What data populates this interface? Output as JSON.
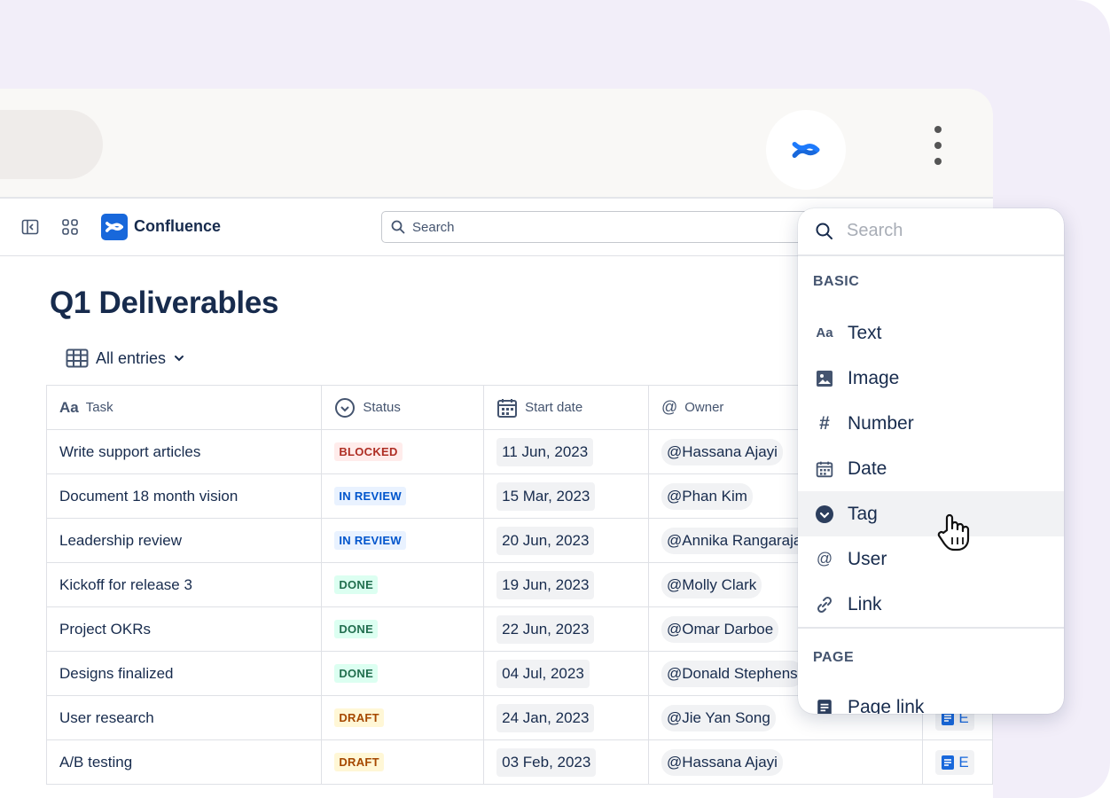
{
  "app": {
    "name": "Confluence",
    "search_placeholder": "Search"
  },
  "page": {
    "title": "Q1 Deliverables",
    "view_label": "All entries"
  },
  "table": {
    "columns": [
      {
        "icon": "text-type-icon",
        "label": "Task"
      },
      {
        "icon": "status-icon",
        "label": "Status"
      },
      {
        "icon": "calendar-icon",
        "label": "Start date"
      },
      {
        "icon": "at-icon",
        "label": "Owner"
      }
    ],
    "rows": [
      {
        "task": "Write support articles",
        "status": "BLOCKED",
        "status_color": "#ae2e24",
        "status_bg": "#ffeceb",
        "date": "11 Jun, 2023",
        "owner": "@Hassana Ajayi",
        "page": ""
      },
      {
        "task": "Document 18 month vision",
        "status": "IN REVIEW",
        "status_color": "#0055cc",
        "status_bg": "#e9f2ff",
        "date": "15 Mar, 2023",
        "owner": "@Phan Kim",
        "page": ""
      },
      {
        "task": "Leadership review",
        "status": "IN REVIEW",
        "status_color": "#0055cc",
        "status_bg": "#e9f2ff",
        "date": "20 Jun, 2023",
        "owner": "@Annika Rangarajan",
        "page": ""
      },
      {
        "task": "Kickoff for release 3",
        "status": "DONE",
        "status_color": "#216e4e",
        "status_bg": "#dcfff1",
        "date": "19 Jun, 2023",
        "owner": "@Molly Clark",
        "page": ""
      },
      {
        "task": "Project OKRs",
        "status": "DONE",
        "status_color": "#216e4e",
        "status_bg": "#dcfff1",
        "date": "22 Jun, 2023",
        "owner": "@Omar Darboe",
        "page": ""
      },
      {
        "task": "Designs finalized",
        "status": "DONE",
        "status_color": "#216e4e",
        "status_bg": "#dcfff1",
        "date": "04 Jul, 2023",
        "owner": "@Donald Stephens",
        "page": ""
      },
      {
        "task": "User research",
        "status": "DRAFT",
        "status_color": "#a54800",
        "status_bg": "#fff7d6",
        "date": "24 Jan, 2023",
        "owner": "@Jie Yan Song",
        "page": "E"
      },
      {
        "task": "A/B testing",
        "status": "DRAFT",
        "status_color": "#a54800",
        "status_bg": "#fff7d6",
        "date": "03 Feb, 2023",
        "owner": "@Hassana Ajayi",
        "page": "E"
      }
    ]
  },
  "dropdown": {
    "search_placeholder": "Search",
    "sections": [
      {
        "title": "BASIC",
        "items": [
          {
            "icon": "text-type-icon",
            "label": "Text"
          },
          {
            "icon": "image-icon",
            "label": "Image"
          },
          {
            "icon": "hash-icon",
            "label": "Number"
          },
          {
            "icon": "calendar-icon",
            "label": "Date"
          },
          {
            "icon": "tag-icon",
            "label": "Tag",
            "hovered": true
          },
          {
            "icon": "at-icon",
            "label": "User"
          },
          {
            "icon": "link-icon",
            "label": "Link"
          }
        ]
      },
      {
        "title": "PAGE",
        "items": [
          {
            "icon": "page-icon",
            "label": "Page link"
          }
        ]
      }
    ]
  },
  "colors": {
    "background": "#f2eef9",
    "brand": "#1868db",
    "text": "#172b4d"
  }
}
